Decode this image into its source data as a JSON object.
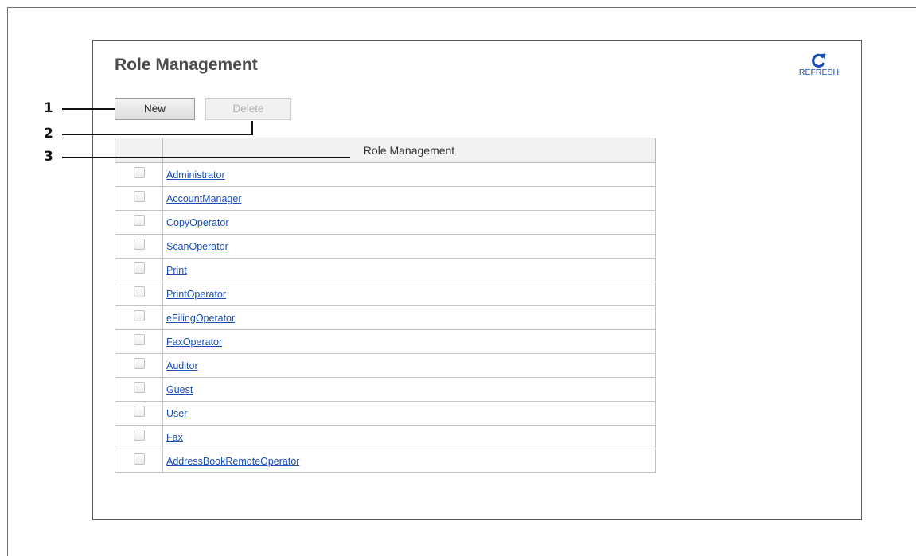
{
  "page": {
    "title": "Role Management",
    "refresh_label": "REFRESH"
  },
  "toolbar": {
    "new_label": "New",
    "delete_label": "Delete"
  },
  "table": {
    "header": "Role Management",
    "rows": [
      {
        "name": "Administrator"
      },
      {
        "name": "AccountManager"
      },
      {
        "name": "CopyOperator"
      },
      {
        "name": "ScanOperator"
      },
      {
        "name": "Print"
      },
      {
        "name": "PrintOperator"
      },
      {
        "name": "eFilingOperator"
      },
      {
        "name": "FaxOperator"
      },
      {
        "name": "Auditor"
      },
      {
        "name": "Guest"
      },
      {
        "name": "User"
      },
      {
        "name": "Fax"
      },
      {
        "name": "AddressBookRemoteOperator"
      }
    ]
  },
  "callouts": [
    "1",
    "2",
    "3"
  ],
  "colors": {
    "link": "#1a4fb2",
    "title": "#4a4a4a",
    "header_bg": "#f2f2f2"
  },
  "icons": {
    "refresh": "refresh-icon"
  }
}
